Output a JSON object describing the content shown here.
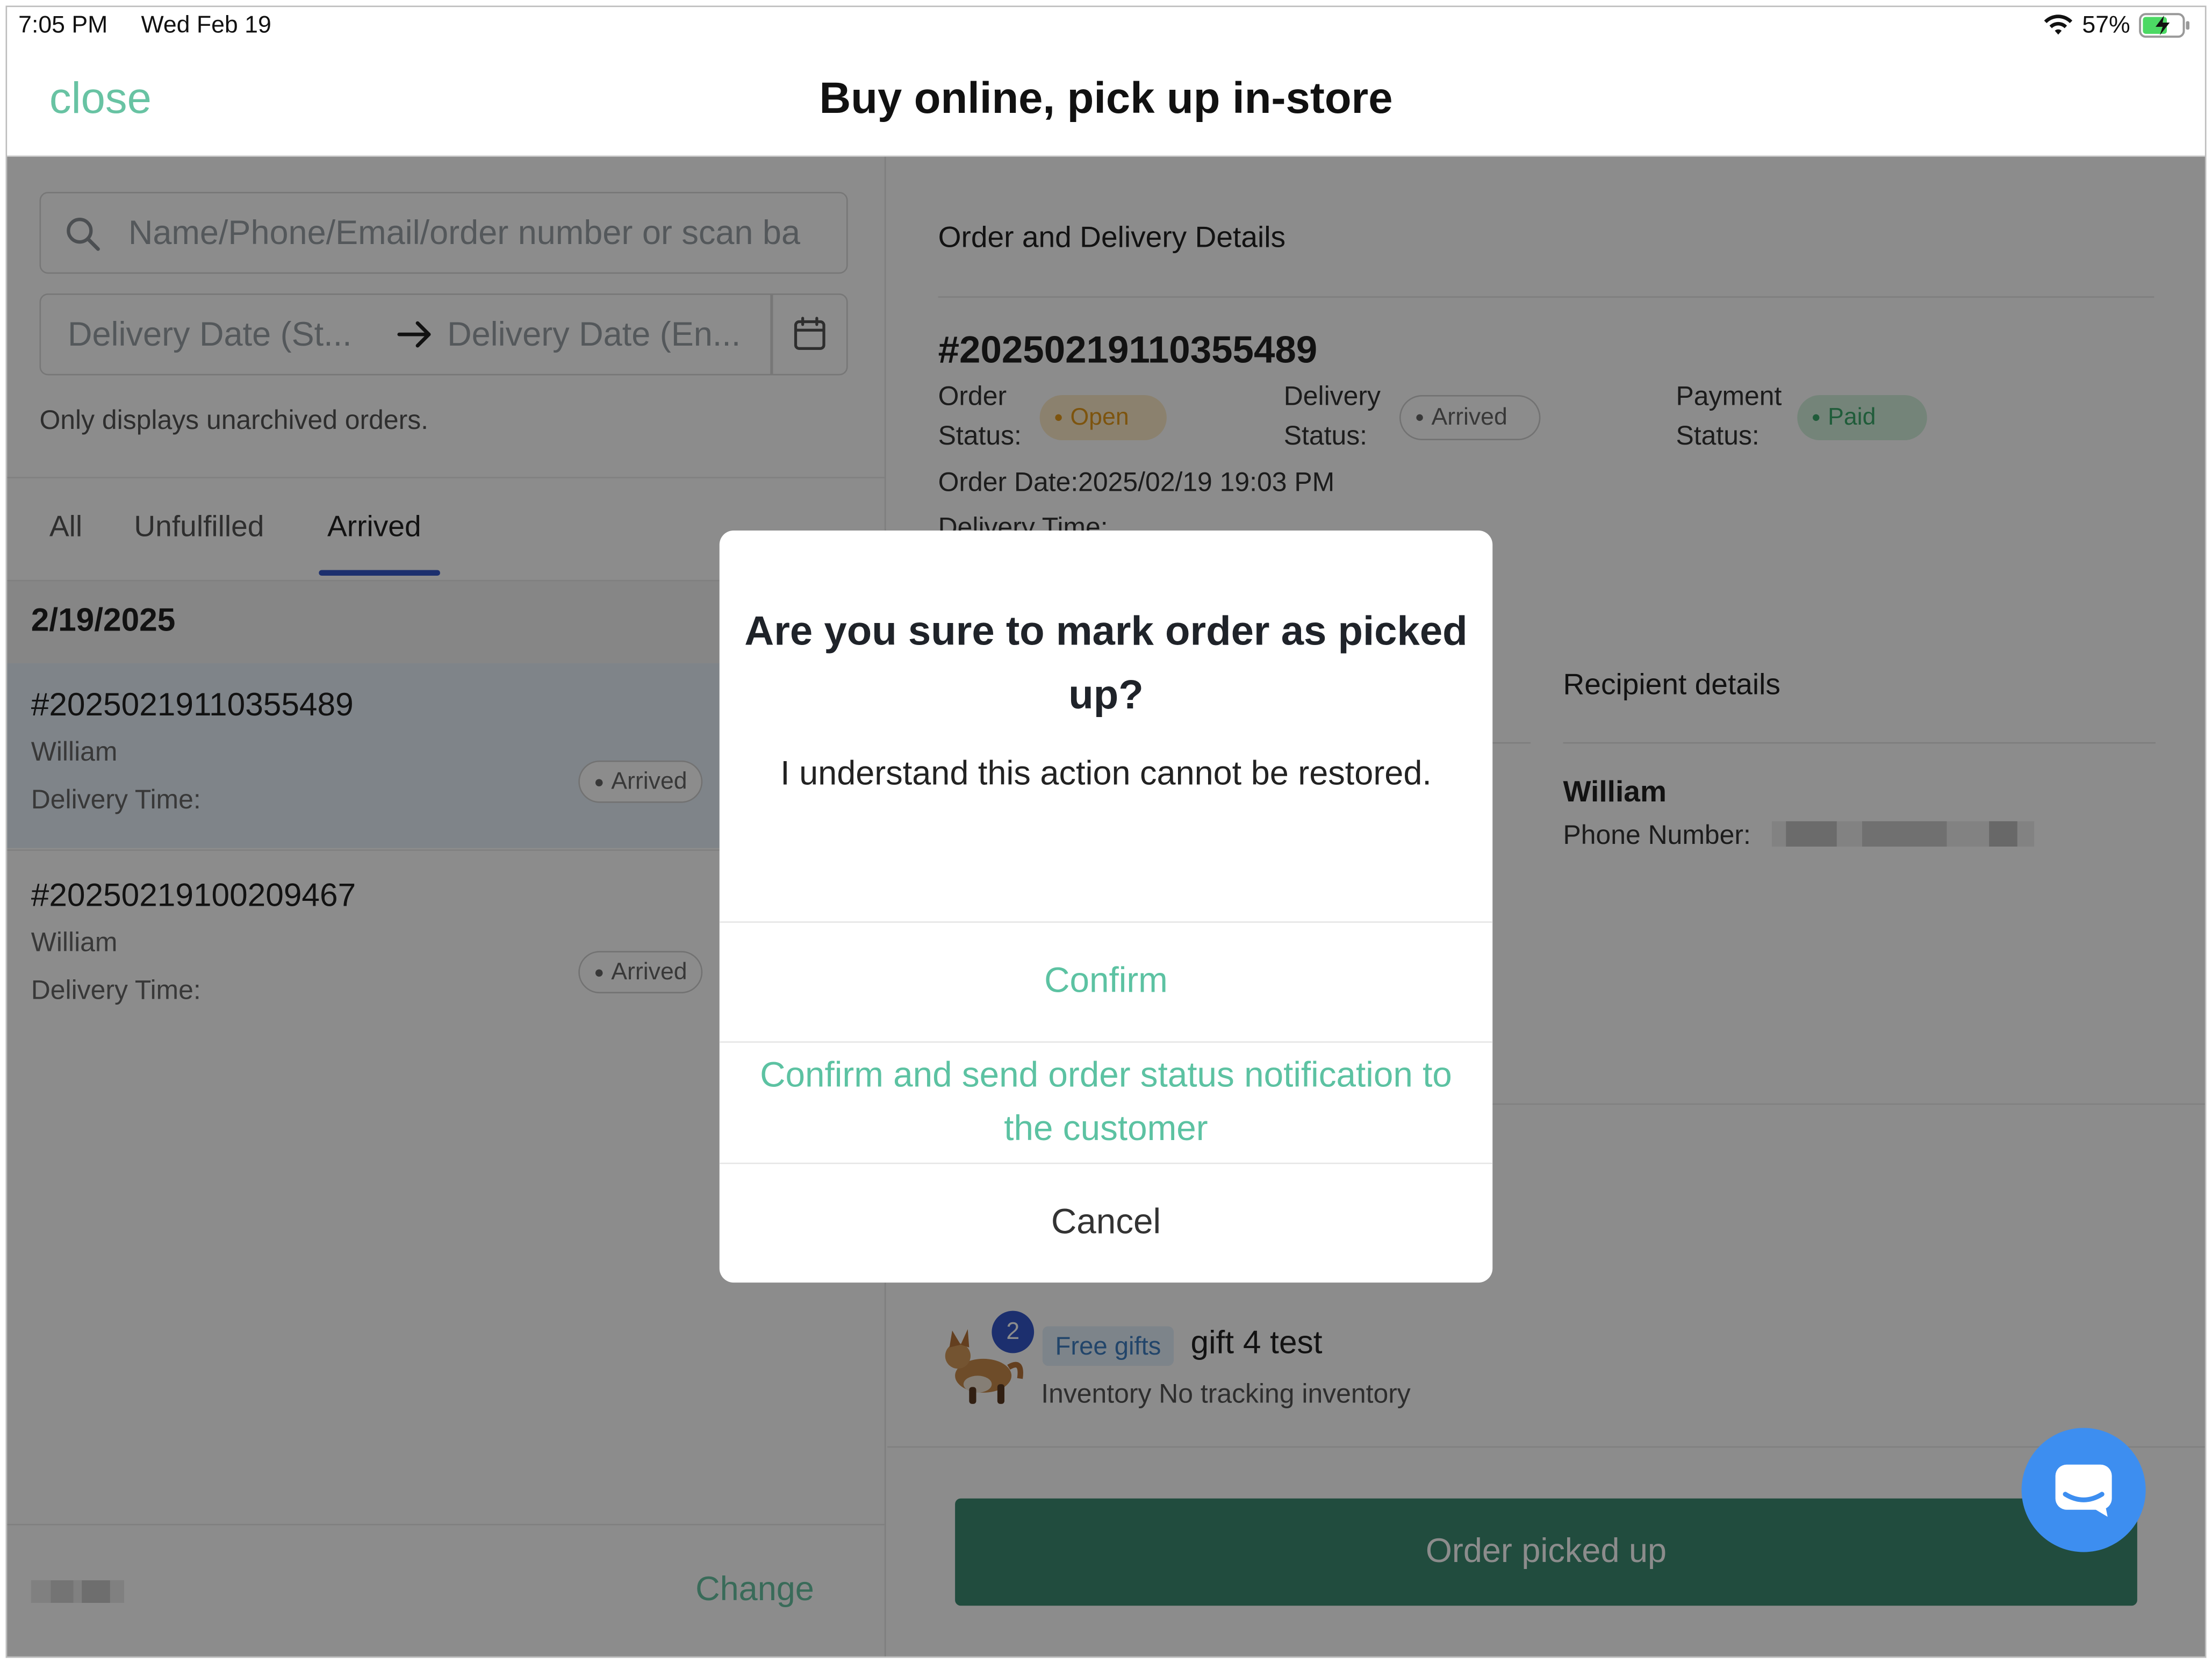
{
  "status_bar": {
    "time": "7:05 PM",
    "date": "Wed Feb 19",
    "battery": "57%"
  },
  "nav": {
    "close_label": "close",
    "title": "Buy online, pick up in-store"
  },
  "filters": {
    "search_placeholder": "Name/Phone/Email/order number or scan ba",
    "date_start_placeholder": "Delivery Date (St...",
    "date_end_placeholder": "Delivery Date (En...",
    "hint": "Only displays unarchived orders."
  },
  "tabs": [
    {
      "label": "All"
    },
    {
      "label": "Unfulfilled"
    },
    {
      "label": "Arrived",
      "active": true
    }
  ],
  "order_list": {
    "group_date": "2/19/2025",
    "orders": [
      {
        "number": "#20250219110355489",
        "customer": "William",
        "delivery_time_label": "Delivery Time:",
        "status": "Arrived",
        "selected": true
      },
      {
        "number": "#20250219100209467",
        "customer": "William",
        "delivery_time_label": "Delivery Time:",
        "status": "Arrived",
        "selected": false
      }
    ]
  },
  "left_footer": {
    "change_label": "Change"
  },
  "details": {
    "section_title": "Order and Delivery Details",
    "order_number": "#20250219110355489",
    "order_status_label_1": "Order",
    "order_status_label_2": "Status:",
    "order_status": "Open",
    "delivery_status_label_1": "Delivery",
    "delivery_status_label_2": "Status:",
    "delivery_status": "Arrived",
    "payment_status_label_1": "Payment",
    "payment_status_label_2": "Status:",
    "payment_status": "Paid",
    "order_date": "Order Date:2025/02/19 19:03 PM",
    "delivery_time_label": "Delivery Time:",
    "recipient_title": "Recipient details",
    "recipient_name": "William",
    "phone_label": "Phone Number:",
    "product": {
      "quantity": "2",
      "tag": "Free gifts",
      "name": "gift 4 test",
      "inventory": "Inventory No tracking inventory"
    },
    "picked_up_button": "Order picked up"
  },
  "modal": {
    "title": "Are you sure to mark order as picked up?",
    "body": "I understand this action cannot be restored.",
    "confirm": "Confirm",
    "confirm_notify": "Confirm and send order status notification to the customer",
    "cancel": "Cancel"
  },
  "colors": {
    "accent_green": "#68c3a3",
    "tab_blue": "#3357c8",
    "primary_button": "#3d8b72",
    "open_orange": "#e39a1b",
    "paid_green": "#3ba86b",
    "chat_blue": "#3d8ef0"
  },
  "icons": [
    "wifi-icon",
    "battery-charging-icon",
    "search-icon",
    "arrow-right-icon",
    "calendar-icon",
    "chat-icon"
  ]
}
